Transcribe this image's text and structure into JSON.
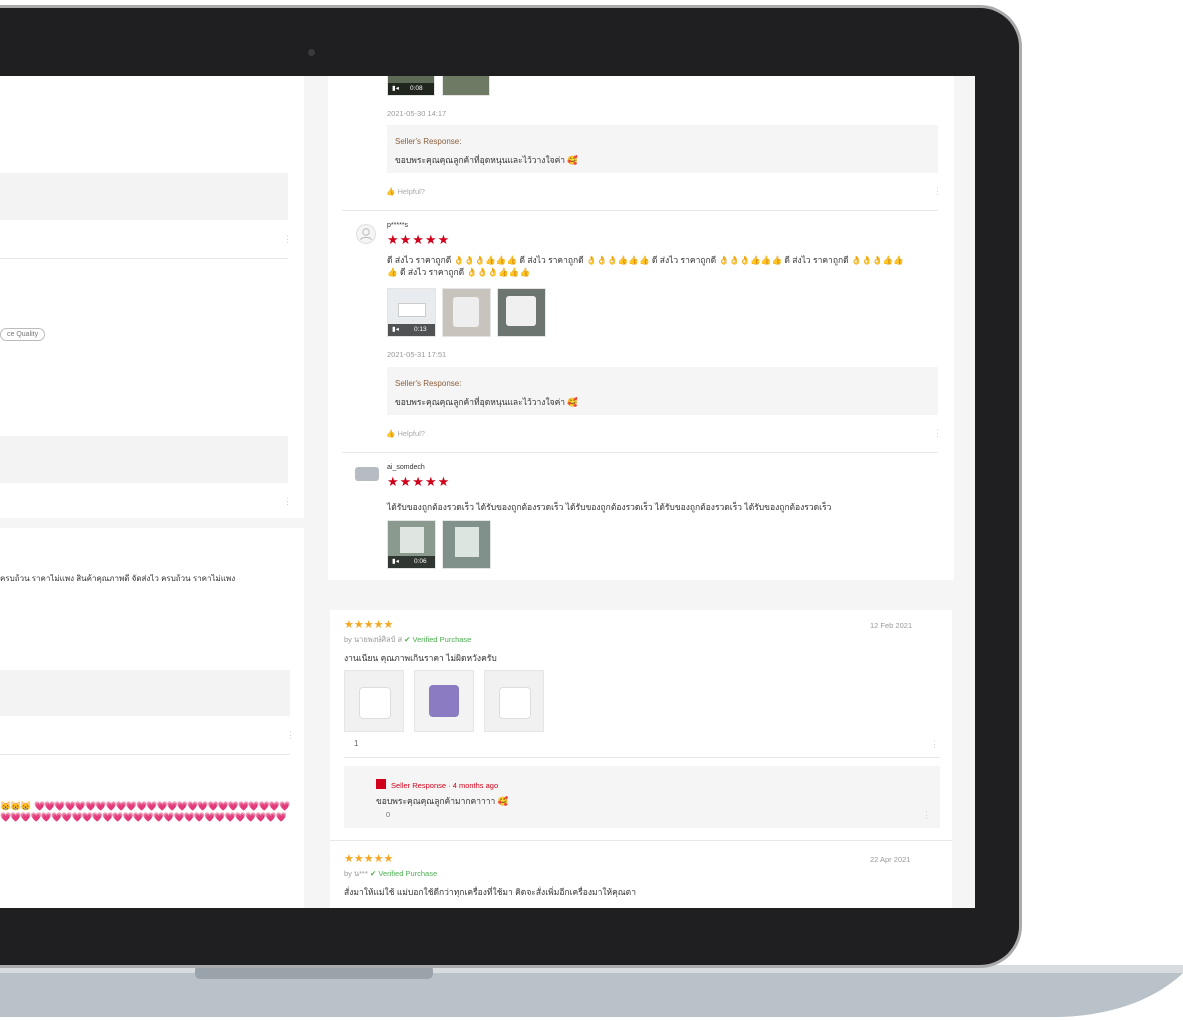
{
  "left_panel": {
    "tag_pill": "ce Quality",
    "review_text": "ครบถ้วน ราคาไม่แพง สินค้าคุณภาพดี จัดส่งไว ครบถ้วน ราคาไม่แพง"
  },
  "shopee_reviews": [
    {
      "date": "2021-05-30 14:17",
      "video_duration": "0:08",
      "seller_response_title": "Seller's Response:",
      "seller_response_text": "ขอบพระคุณคุณลูกค้าที่อุดหนุนและไว้วางใจค่า 🥰",
      "helpful_label": "Helpful?"
    },
    {
      "username": "p*****s",
      "stars": "★★★★★",
      "text_line1": "ดี ส่งไว ราคาถูกดี 👌👌👌👍👍👍 ดี ส่งไว ราคาถูกดี 👌👌👌👍👍👍 ดี ส่งไว ราคาถูกดี 👌👌👌👍👍👍 ดี ส่งไว ราคาถูกดี 👌👌👌👍👍",
      "text_line2": "👍 ดี ส่งไว ราคาถูกดี 👌👌👌👍👍👍",
      "video_duration": "0:13",
      "date": "2021-05-31 17:51",
      "seller_response_title": "Seller's Response:",
      "seller_response_text": "ขอบพระคุณคุณลูกค้าที่อุดหนุนและไว้วางใจค่า 🥰",
      "helpful_label": "Helpful?"
    },
    {
      "username": "ai_somdech",
      "stars": "★★★★★",
      "text": "ได้รับของถูกต้องรวดเร็ว ได้รับของถูกต้องรวดเร็ว ได้รับของถูกต้องรวดเร็ว ได้รับของถูกต้องรวดเร็ว ได้รับของถูกต้องรวดเร็ว",
      "video_duration": "0:06"
    }
  ],
  "lazada_reviews": [
    {
      "stars": "★★★★★",
      "date": "12 Feb 2021",
      "by": "by นายพงษ์ศิลป์ ส",
      "verified": "Verified Purchase",
      "text": "งานเนียน คุณภาพเกินราคา ไม่ผิดหวังครับ",
      "like_count": "1",
      "seller_response_label": "Seller Response · 4 months ago",
      "seller_response_text": "ขอบพระคุณคุณลูกค้ามากคาาาา 🥰",
      "seller_like_count": "0"
    },
    {
      "stars": "★★★★★",
      "date": "22 Apr 2021",
      "by": "by น***",
      "verified": "Verified Purchase",
      "text": "สั่งมาให้แม่ใช้ แม่บอกใช้ดีกว่าทุกเครื่องที่ใช้มา คิดจะสั่งเพิ่มอีกเครื่องมาให้คุณตา"
    }
  ],
  "colors": {
    "shopee_star": "#d0011b",
    "lazada_star": "#f5a623",
    "verified": "#4caf50"
  }
}
